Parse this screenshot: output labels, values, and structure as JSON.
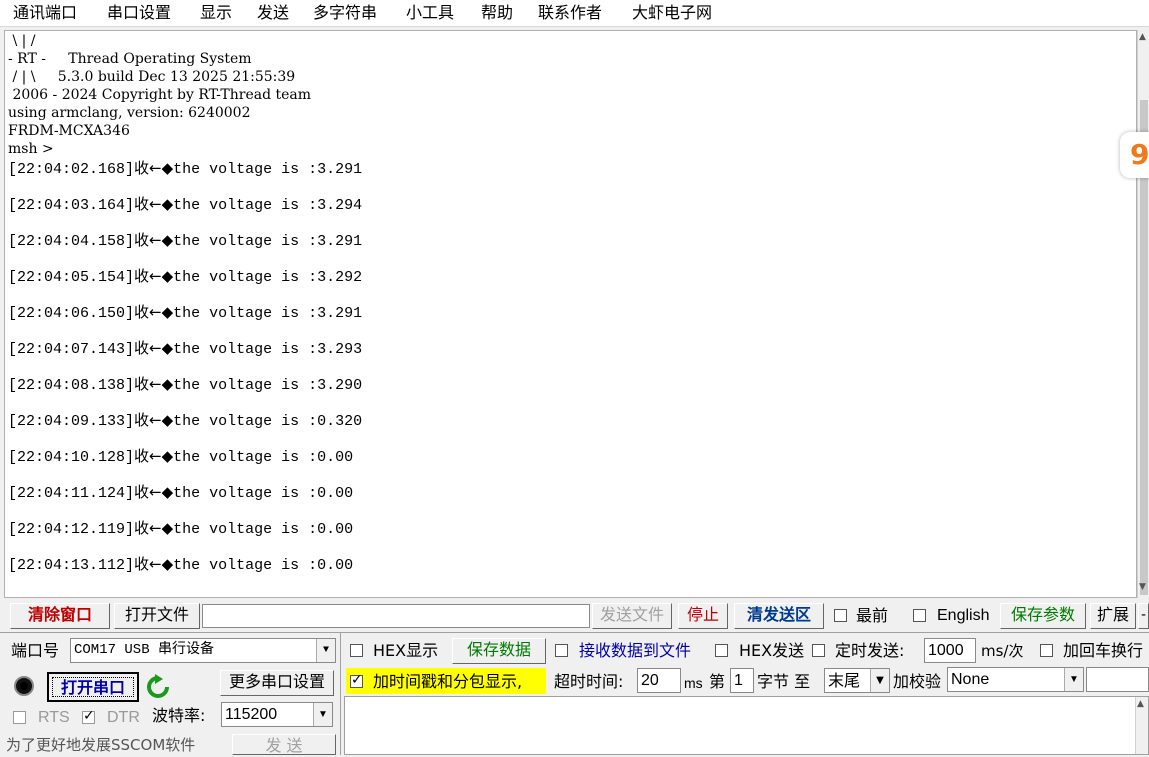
{
  "menu": [
    "通讯端口",
    "串口设置",
    "显示",
    "发送",
    "多字符串",
    "小工具",
    "帮助",
    "联系作者",
    "大虾电子网"
  ],
  "terminal": {
    "header_lines": [
      " \\ | /",
      "- RT -     Thread Operating System",
      " / | \\     5.3.0 build Dec 13 2025 21:55:39",
      " 2006 - 2024 Copyright by RT-Thread team",
      "using armclang, version: 6240002",
      "FRDM-MCXA346",
      "msh >"
    ],
    "log": [
      {
        "time": "[22:04:02.168]",
        "tag": "收←◆",
        "text": "the voltage is :3.291"
      },
      {
        "time": "[22:04:03.164]",
        "tag": "收←◆",
        "text": "the voltage is :3.294"
      },
      {
        "time": "[22:04:04.158]",
        "tag": "收←◆",
        "text": "the voltage is :3.291"
      },
      {
        "time": "[22:04:05.154]",
        "tag": "收←◆",
        "text": "the voltage is :3.292"
      },
      {
        "time": "[22:04:06.150]",
        "tag": "收←◆",
        "text": "the voltage is :3.291"
      },
      {
        "time": "[22:04:07.143]",
        "tag": "收←◆",
        "text": "the voltage is :3.293"
      },
      {
        "time": "[22:04:08.138]",
        "tag": "收←◆",
        "text": "the voltage is :3.290"
      },
      {
        "time": "[22:04:09.133]",
        "tag": "收←◆",
        "text": "the voltage is :0.320"
      },
      {
        "time": "[22:04:10.128]",
        "tag": "收←◆",
        "text": "the voltage is :0.00"
      },
      {
        "time": "[22:04:11.124]",
        "tag": "收←◆",
        "text": "the voltage is :0.00"
      },
      {
        "time": "[22:04:12.119]",
        "tag": "收←◆",
        "text": "the voltage is :0.00"
      },
      {
        "time": "[22:04:13.112]",
        "tag": "收←◆",
        "text": "the voltage is :0.00"
      }
    ]
  },
  "side_badge": "9",
  "toolbar": {
    "clear_window": "清除窗口",
    "open_file": "打开文件",
    "file_path": "",
    "send_file": "发送文件",
    "stop": "停止",
    "clear_send": "清发送区",
    "latest_label": "最前",
    "english_label": "English",
    "save_params": "保存参数",
    "expand": "扩展",
    "dash": "-"
  },
  "port_panel": {
    "port_label": "端口号",
    "port_value": "COM17 USB 串行设备",
    "open_port": "打开串口",
    "more_settings": "更多串口设置",
    "rts_label": "RTS",
    "dtr_label": "DTR",
    "baud_label": "波特率:",
    "baud_value": "115200",
    "promo": "为了更好地发展SSCOM软件",
    "send_button": "发 送"
  },
  "options": {
    "hex_display": "HEX显示",
    "save_data": "保存数据",
    "recv_to_file": "接收数据到文件",
    "hex_send": "HEX发送",
    "timed_send": "定时发送:",
    "timed_value": "1000",
    "timed_unit": "ms/次",
    "add_crlf": "加回车换行",
    "timestamp": "加时间戳和分包显示,",
    "timeout_label": "超时时间:",
    "timeout_value": "20",
    "timeout_unit": "ms",
    "byte_prefix": "第",
    "byte_value": "1",
    "byte_to": "字节 至",
    "end_value": "末尾",
    "checksum_label": "加校验",
    "checksum_value": "None"
  },
  "colors": {
    "clear_red": "#c00000",
    "stop_red": "#c00000",
    "clear_send_blue": "#003a8c",
    "save_params_green": "#007a00",
    "save_data_green": "#007a00",
    "recv_file_blue": "#0000aa",
    "timestamp_highlight": "#ffff00",
    "open_port_blue": "#0000aa"
  }
}
